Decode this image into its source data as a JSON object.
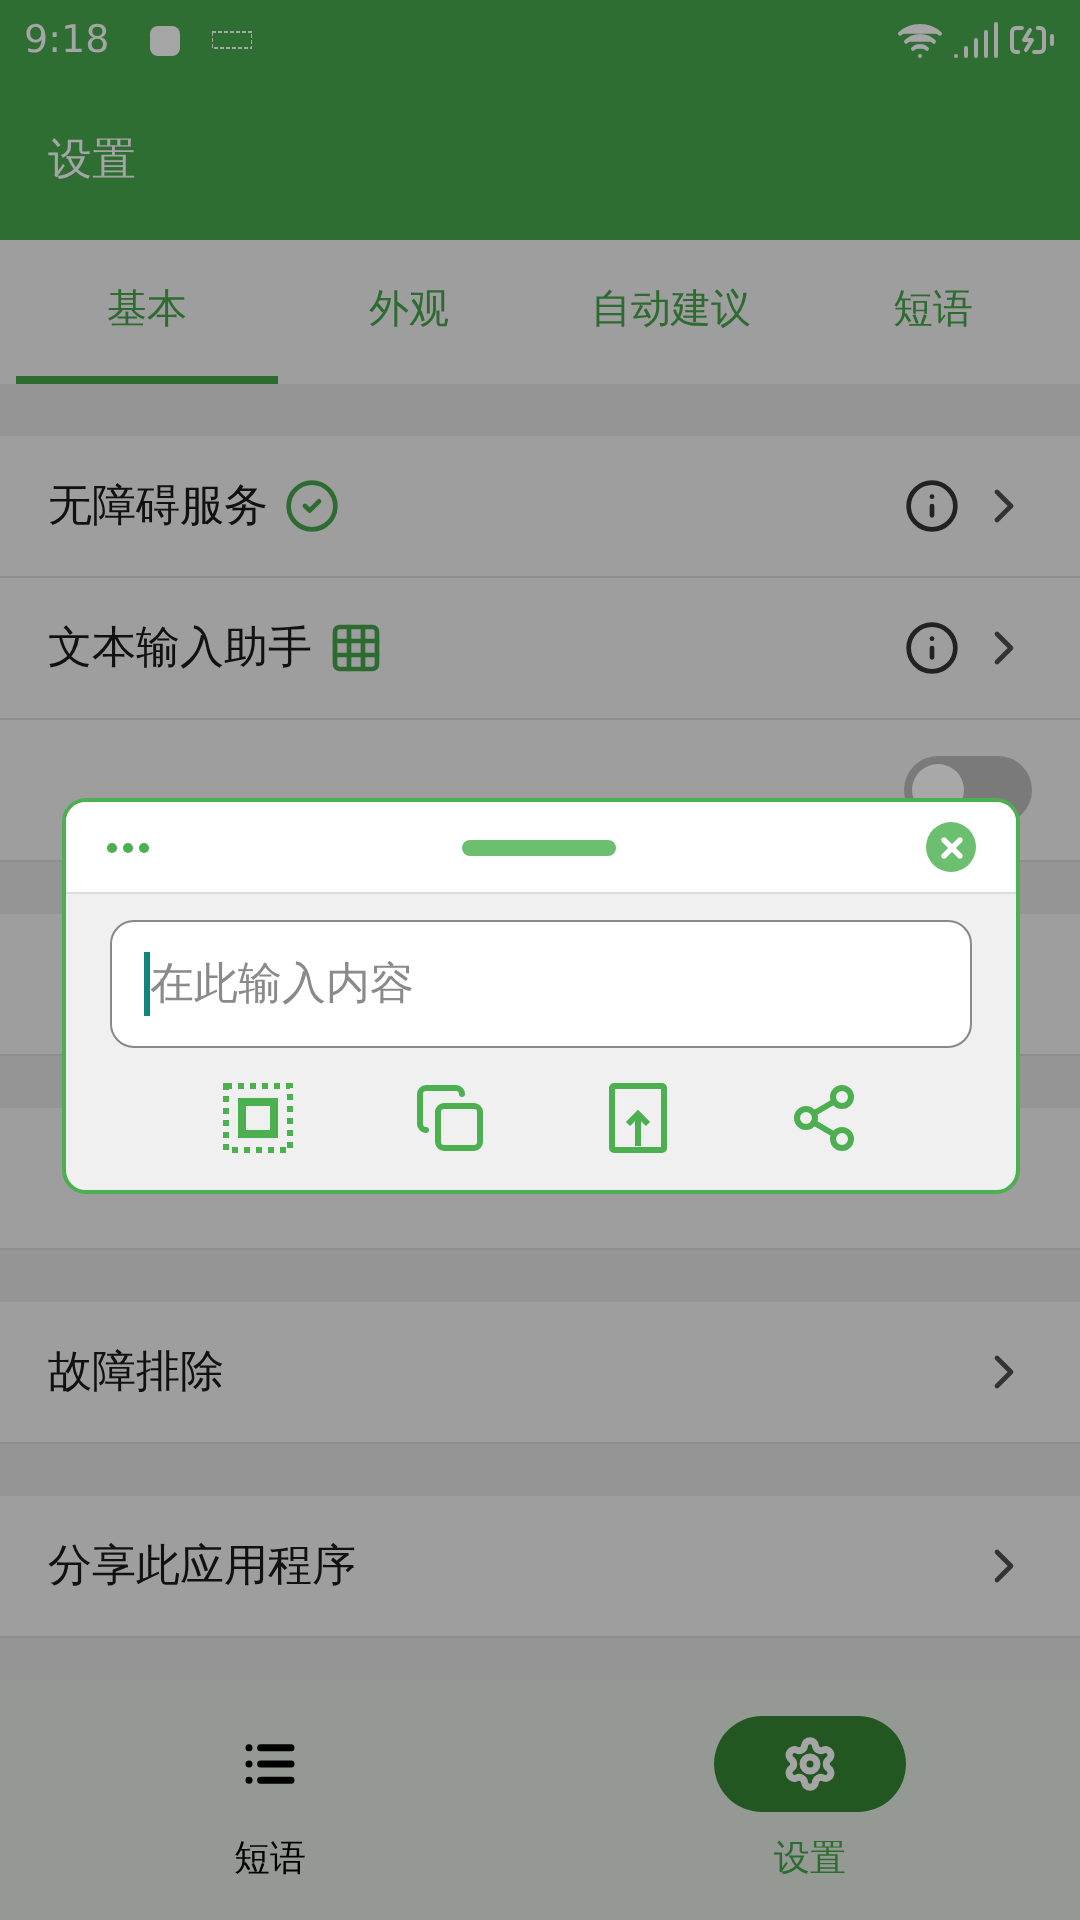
{
  "status_bar": {
    "time": "9:18"
  },
  "app_bar": {
    "title": "设置"
  },
  "tabs": [
    {
      "label": "基本",
      "selected": true
    },
    {
      "label": "外观",
      "selected": false
    },
    {
      "label": "自动建议",
      "selected": false
    },
    {
      "label": "短语",
      "selected": false
    }
  ],
  "sections": [
    {
      "rows": [
        {
          "label": "无障碍服务",
          "kind": "check_info"
        },
        {
          "label": "文本输入助手",
          "kind": "grid_info"
        },
        {
          "kind": "toggle",
          "on": false
        }
      ]
    },
    {
      "rows": [
        {
          "kind": "blank"
        }
      ]
    },
    {
      "rows": [
        {
          "kind": "blank"
        }
      ]
    },
    {
      "rows": [
        {
          "label": "故障排除",
          "kind": "chevron"
        }
      ]
    },
    {
      "rows": [
        {
          "label": "分享此应用程序",
          "kind": "chevron"
        }
      ]
    }
  ],
  "floating_panel": {
    "input": {
      "placeholder": "在此输入内容"
    }
  },
  "bottom_nav": [
    {
      "label": "短语",
      "selected": false
    },
    {
      "label": "设置",
      "selected": true
    }
  ]
}
